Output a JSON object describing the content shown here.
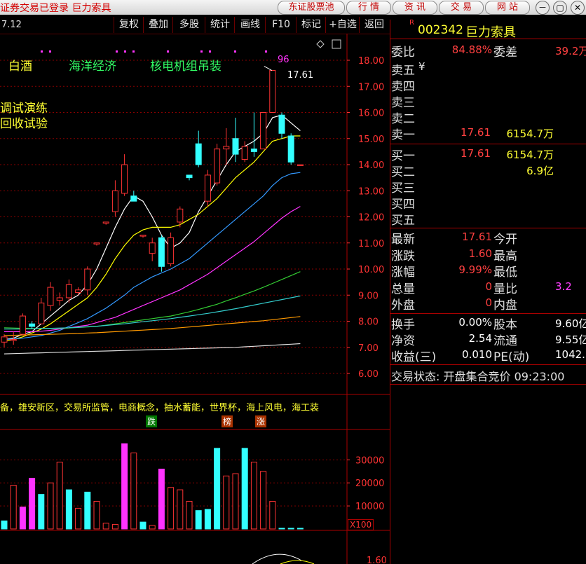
{
  "titlebar": {
    "app_title": "证券交易已登录  巨力索具",
    "buttons": [
      "东证股票池",
      "行 情",
      "资 讯",
      "交 易",
      "网 站"
    ],
    "window_controls": [
      "－",
      "▢",
      "✕"
    ]
  },
  "toolbar": {
    "items": [
      "复权",
      "叠加",
      "多股",
      "统计",
      "画线",
      "F10",
      "标记",
      "+自选",
      "返回"
    ]
  },
  "chart_header": {
    "value": "7.12",
    "concepts": [
      "白酒",
      "海洋经济",
      "核电机组吊装"
    ],
    "sub_concepts": [
      "调试演练",
      "回收试验"
    ],
    "peak_label": "96",
    "peak_price": "17.61"
  },
  "chart_data": {
    "type": "candlestick",
    "price_axis": [
      "18.00",
      "17.00",
      "16.00",
      "15.00",
      "14.00",
      "13.00",
      "12.00",
      "11.00",
      "10.00",
      "9.00",
      "8.00",
      "7.00",
      "6.00"
    ],
    "ylim": [
      6.0,
      18.0
    ],
    "candles": [
      {
        "o": 7.2,
        "h": 7.5,
        "l": 7.0,
        "c": 7.4
      },
      {
        "o": 7.3,
        "h": 7.6,
        "l": 7.1,
        "c": 7.3
      },
      {
        "o": 7.5,
        "h": 8.3,
        "l": 7.5,
        "c": 8.2
      },
      {
        "o": 7.9,
        "h": 8.0,
        "l": 7.7,
        "c": 7.8
      },
      {
        "o": 7.9,
        "h": 8.9,
        "l": 7.9,
        "c": 8.7
      },
      {
        "o": 8.6,
        "h": 9.5,
        "l": 8.4,
        "c": 9.3
      },
      {
        "o": 8.8,
        "h": 9.1,
        "l": 8.6,
        "c": 8.9
      },
      {
        "o": 8.9,
        "h": 9.6,
        "l": 8.7,
        "c": 9.4
      },
      {
        "o": 9.1,
        "h": 9.3,
        "l": 9.0,
        "c": 9.2
      },
      {
        "o": 9.2,
        "h": 10.1,
        "l": 9.0,
        "c": 10.0
      },
      {
        "o": 11.0,
        "h": 11.0,
        "l": 10.9,
        "c": 11.0
      },
      {
        "o": 11.8,
        "h": 11.8,
        "l": 11.7,
        "c": 11.8
      },
      {
        "o": 12.2,
        "h": 13.4,
        "l": 12.0,
        "c": 13.0
      },
      {
        "o": 12.9,
        "h": 14.4,
        "l": 12.8,
        "c": 14.0
      },
      {
        "o": 12.8,
        "h": 13.0,
        "l": 12.6,
        "c": 12.6
      },
      {
        "o": 11.3,
        "h": 11.3,
        "l": 11.2,
        "c": 11.3
      },
      {
        "o": 10.6,
        "h": 11.2,
        "l": 10.3,
        "c": 11.0
      },
      {
        "o": 11.2,
        "h": 11.3,
        "l": 9.9,
        "c": 10.1
      },
      {
        "o": 10.2,
        "h": 11.4,
        "l": 10.1,
        "c": 11.2
      },
      {
        "o": 11.8,
        "h": 12.4,
        "l": 11.6,
        "c": 12.3
      },
      {
        "o": 13.6,
        "h": 13.6,
        "l": 13.4,
        "c": 13.5
      },
      {
        "o": 14.8,
        "h": 15.3,
        "l": 13.9,
        "c": 14.0
      },
      {
        "o": 12.6,
        "h": 13.8,
        "l": 12.4,
        "c": 13.6
      },
      {
        "o": 13.3,
        "h": 14.8,
        "l": 13.2,
        "c": 14.6
      },
      {
        "o": 14.6,
        "h": 15.4,
        "l": 14.0,
        "c": 14.7
      },
      {
        "o": 15.0,
        "h": 15.8,
        "l": 14.1,
        "c": 14.4
      },
      {
        "o": 14.2,
        "h": 14.9,
        "l": 14.1,
        "c": 14.7
      },
      {
        "o": 14.6,
        "h": 16.0,
        "l": 14.3,
        "c": 14.5
      },
      {
        "o": 14.6,
        "h": 16.0,
        "l": 14.6,
        "c": 16.0
      },
      {
        "o": 16.0,
        "h": 17.61,
        "l": 16.0,
        "c": 17.61
      },
      {
        "o": 15.9,
        "h": 16.0,
        "l": 15.0,
        "c": 15.2
      },
      {
        "o": 15.1,
        "h": 15.2,
        "l": 14.0,
        "c": 14.1
      },
      {
        "o": 14.0,
        "h": 14.0,
        "l": 14.0,
        "c": 14.0
      }
    ],
    "ma_lines": [
      {
        "color": "#ffffff",
        "values": [
          7.3,
          7.35,
          7.5,
          7.6,
          7.9,
          8.2,
          8.5,
          8.8,
          9.0,
          9.4,
          10.0,
          10.8,
          11.6,
          12.3,
          12.8,
          12.6,
          12.0,
          11.3,
          10.8,
          11.0,
          11.4,
          12.2,
          12.8,
          13.4,
          14.0,
          14.5,
          14.7,
          14.9,
          15.2,
          15.8,
          15.9,
          15.6,
          15.3
        ]
      },
      {
        "color": "#ffff00",
        "values": [
          7.25,
          7.3,
          7.4,
          7.55,
          7.7,
          7.9,
          8.15,
          8.4,
          8.65,
          8.9,
          9.3,
          9.8,
          10.4,
          10.9,
          11.3,
          11.5,
          11.6,
          11.6,
          11.6,
          11.7,
          11.9,
          12.1,
          12.4,
          12.7,
          13.1,
          13.5,
          13.8,
          14.1,
          14.5,
          14.9,
          15.0,
          15.1,
          15.1
        ]
      },
      {
        "color": "#3399ff",
        "values": [
          7.3,
          7.32,
          7.35,
          7.4,
          7.45,
          7.55,
          7.65,
          7.8,
          7.95,
          8.1,
          8.3,
          8.5,
          8.75,
          9.0,
          9.3,
          9.5,
          9.7,
          9.85,
          10.0,
          10.2,
          10.4,
          10.7,
          11.0,
          11.3,
          11.6,
          11.9,
          12.2,
          12.5,
          12.8,
          13.2,
          13.5,
          13.65,
          13.7
        ]
      },
      {
        "color": "#ff33ff",
        "values": [
          7.6,
          7.6,
          7.6,
          7.6,
          7.62,
          7.65,
          7.7,
          7.75,
          7.8,
          7.85,
          7.95,
          8.05,
          8.15,
          8.3,
          8.45,
          8.6,
          8.75,
          8.9,
          9.05,
          9.2,
          9.4,
          9.6,
          9.8,
          10.05,
          10.3,
          10.55,
          10.8,
          11.05,
          11.35,
          11.65,
          11.95,
          12.2,
          12.4
        ]
      },
      {
        "color": "#33cc33",
        "values": [
          7.75,
          7.74,
          7.73,
          7.72,
          7.72,
          7.72,
          7.73,
          7.74,
          7.76,
          7.78,
          7.8,
          7.85,
          7.9,
          7.95,
          8.0,
          8.05,
          8.1,
          8.15,
          8.2,
          8.28,
          8.36,
          8.45,
          8.55,
          8.65,
          8.78,
          8.9,
          9.03,
          9.16,
          9.3,
          9.45,
          9.6,
          9.75,
          9.9
        ]
      },
      {
        "color": "#33cccc",
        "values": [
          7.7,
          7.7,
          7.7,
          7.71,
          7.72,
          7.73,
          7.74,
          7.75,
          7.77,
          7.79,
          7.81,
          7.84,
          7.87,
          7.9,
          7.94,
          7.98,
          8.02,
          8.06,
          8.1,
          8.15,
          8.2,
          8.25,
          8.3,
          8.36,
          8.42,
          8.48,
          8.55,
          8.62,
          8.69,
          8.76,
          8.83,
          8.9,
          8.97
        ]
      },
      {
        "color": "#ff9900",
        "values": [
          7.45,
          7.46,
          7.47,
          7.48,
          7.49,
          7.5,
          7.51,
          7.52,
          7.53,
          7.55,
          7.56,
          7.58,
          7.6,
          7.62,
          7.64,
          7.66,
          7.68,
          7.7,
          7.72,
          7.75,
          7.78,
          7.81,
          7.84,
          7.87,
          7.9,
          7.93,
          7.96,
          7.99,
          8.02,
          8.06,
          8.1,
          8.14,
          8.18
        ]
      },
      {
        "color": "#dddddd",
        "values": [
          6.75,
          6.76,
          6.77,
          6.78,
          6.79,
          6.8,
          6.81,
          6.82,
          6.83,
          6.84,
          6.85,
          6.86,
          6.87,
          6.88,
          6.89,
          6.9,
          6.91,
          6.92,
          6.93,
          6.94,
          6.95,
          6.96,
          6.97,
          6.98,
          6.99,
          7.0,
          7.02,
          7.04,
          7.06,
          7.08,
          7.1,
          7.12,
          7.14
        ]
      }
    ],
    "volume_axis": [
      "30000",
      "20000",
      "10000"
    ],
    "volume_unit": "X100",
    "volume_ylim": [
      0,
      38000
    ],
    "volumes": [
      {
        "v": 3500,
        "c": "#33ffff"
      },
      {
        "v": 19000,
        "c": "#ff3333"
      },
      {
        "v": 9500,
        "c": "#ff33ff"
      },
      {
        "v": 22000,
        "c": "#ff33ff"
      },
      {
        "v": 15000,
        "c": "#33ffff"
      },
      {
        "v": 20000,
        "c": "#ff3333"
      },
      {
        "v": 29000,
        "c": "#ff3333"
      },
      {
        "v": 17000,
        "c": "#33ffff"
      },
      {
        "v": 9000,
        "c": "#ff3333"
      },
      {
        "v": 16000,
        "c": "#33ffff"
      },
      {
        "v": 12000,
        "c": "#ff3333"
      },
      {
        "v": 2500,
        "c": "#ff3333"
      },
      {
        "v": 2000,
        "c": "#ff3333"
      },
      {
        "v": 37000,
        "c": "#ff33ff"
      },
      {
        "v": 33000,
        "c": "#ff3333"
      },
      {
        "v": 3000,
        "c": "#33ffff"
      },
      {
        "v": 1500,
        "c": "#ff3333"
      },
      {
        "v": 26000,
        "c": "#ff33ff"
      },
      {
        "v": 18000,
        "c": "#ff3333"
      },
      {
        "v": 17000,
        "c": "#ff3333"
      },
      {
        "v": 12000,
        "c": "#ff3333"
      },
      {
        "v": 8000,
        "c": "#33ffff"
      },
      {
        "v": 8500,
        "c": "#33ffff"
      },
      {
        "v": 35000,
        "c": "#33ffff"
      },
      {
        "v": 23000,
        "c": "#ff3333"
      },
      {
        "v": 24000,
        "c": "#ff3333"
      },
      {
        "v": 35000,
        "c": "#33ffff"
      },
      {
        "v": 29000,
        "c": "#ff3333"
      },
      {
        "v": 25000,
        "c": "#ff3333"
      },
      {
        "v": 12000,
        "c": "#ff3333"
      },
      {
        "v": 0,
        "c": "#33ffff"
      },
      {
        "v": 0,
        "c": "#33ffff"
      },
      {
        "v": 0,
        "c": "#33ffff"
      }
    ],
    "indicator_axis": [
      "1.60"
    ]
  },
  "concept_strip": "备，雄安新区，交易所监管，电商概念，抽水蓄能，世界杯，海上风电，海工装",
  "markers": [
    "跌",
    "榜",
    "涨"
  ],
  "right_panel": {
    "code_marker": "R",
    "code": "002342",
    "name": "巨力索具",
    "weibi_label": "委比",
    "weibi_value": "84.88%",
    "weicha_label": "委差",
    "weicha_value": "39.2万",
    "sell_labels": [
      "卖五",
      "卖四",
      "卖三",
      "卖二",
      "卖一"
    ],
    "sell5_extra": "¥",
    "sell1_price": "17.61",
    "sell1_vol": "6154.7万",
    "buy_labels": [
      "买一",
      "买二",
      "买三",
      "买四",
      "买五"
    ],
    "buy1_price": "17.61",
    "buy1_vol": "6154.7万",
    "buy2_vol": "6.9亿",
    "quote_rows": [
      {
        "l": "最新",
        "v": "17.61",
        "l2": "今开",
        "v2": ""
      },
      {
        "l": "涨跌",
        "v": "1.60",
        "l2": "最高",
        "v2": ""
      },
      {
        "l": "涨幅",
        "v": "9.99%",
        "l2": "最低",
        "v2": ""
      },
      {
        "l": "总量",
        "v": "0",
        "l2": "量比",
        "v2": "3.2"
      },
      {
        "l": "外盘",
        "v": "0",
        "l2": "内盘",
        "v2": ""
      }
    ],
    "fund_rows": [
      {
        "l": "换手",
        "v": "0.00%",
        "l2": "股本",
        "v2": "9.60亿"
      },
      {
        "l": "净资",
        "v": "2.54",
        "l2": "流通",
        "v2": "9.55亿"
      },
      {
        "l": "收益(三)",
        "v": "0.010",
        "l2": "PE(动)",
        "v2": "1042."
      }
    ],
    "trade_status": "交易状态: 开盘集合竞价 09:23:00"
  },
  "colors": {
    "up": "#ff3333",
    "down": "#33ffff",
    "grid": "#aa0000",
    "bg": "#000000"
  }
}
